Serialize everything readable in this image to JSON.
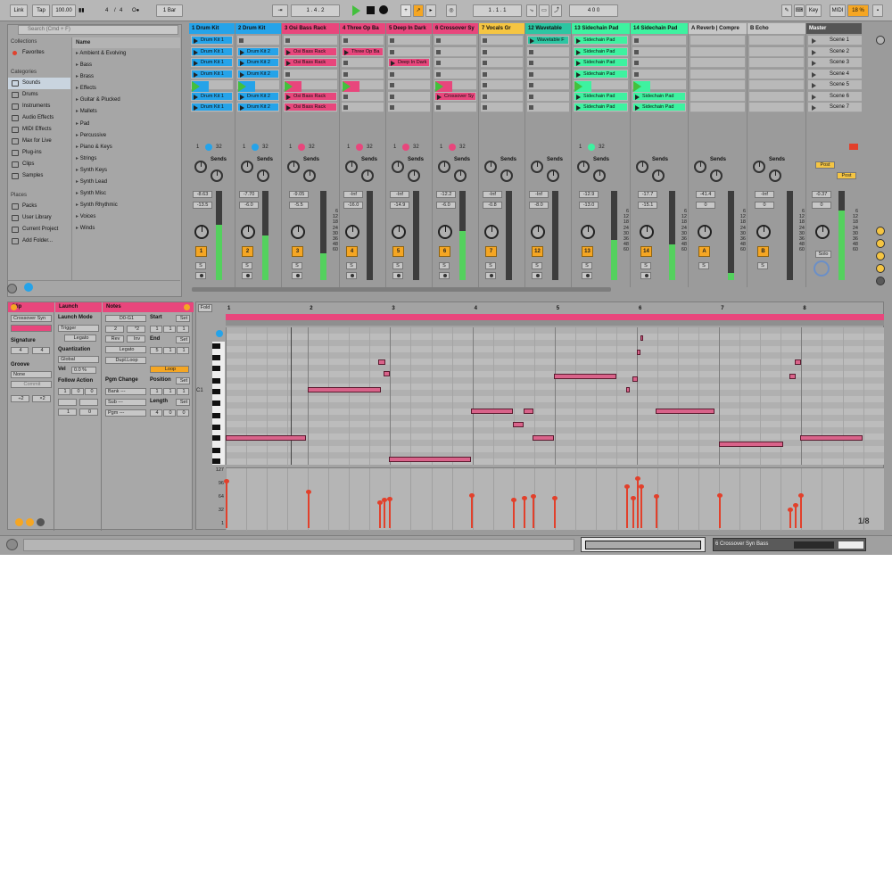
{
  "topbar": {
    "link": "Link",
    "tap": "Tap",
    "tempo": "100.00",
    "signature_num": "4",
    "signature_den": "4",
    "metronome": "O●",
    "quantize": "1 Bar",
    "position": "1 . 4 . 2",
    "arrangement_position": "1 . 1 . 1",
    "loop_length": "4 0 0",
    "key": "Key",
    "midi": "MIDI",
    "cpu": "18 %"
  },
  "browser": {
    "search_placeholder": "Search (Cmd + F)",
    "collections_header": "Collections",
    "favorites": "Favorites",
    "categories_header": "Categories",
    "categories": [
      "Sounds",
      "Drums",
      "Instruments",
      "Audio Effects",
      "MIDI Effects",
      "Max for Live",
      "Plug-ins",
      "Clips",
      "Samples"
    ],
    "places_header": "Places",
    "places": [
      "Packs",
      "User Library",
      "Current Project",
      "Add Folder..."
    ],
    "name_header": "Name",
    "items": [
      "Ambient & Evolving",
      "Bass",
      "Brass",
      "Effects",
      "Guitar & Plucked",
      "Mallets",
      "Pad",
      "Percussive",
      "Piano & Keys",
      "Strings",
      "Synth Keys",
      "Synth Lead",
      "Synth Misc",
      "Synth Rhythmic",
      "Voices",
      "Winds"
    ]
  },
  "tracks": [
    {
      "name": "1 Drum Kit",
      "color": "#25a3e9",
      "clips": [
        "Drum Kit 1",
        "Drum Kit 1",
        "Drum Kit 1",
        "Drum Kit 1",
        "Drum Kit 1",
        "Drum Kit 1",
        "Drum Kit 1"
      ],
      "in": "1",
      "out": "32",
      "vol_a": "-8.63",
      "vol_b": "-13.5",
      "num": "1",
      "meter": 0.62
    },
    {
      "name": "2 Drum Kit",
      "color": "#25a3e9",
      "clips": [
        "",
        "Drum Kit 2",
        "Drum Kit 2",
        "Drum Kit 2",
        "Drum Kit 2",
        "Drum Kit 2",
        "Drum Kit 2"
      ],
      "in": "1",
      "out": "32",
      "vol_a": "-7.70",
      "vol_b": "-6.0",
      "num": "2",
      "meter": 0.5
    },
    {
      "name": "3 Osi Bass Rack",
      "color": "#e8467c",
      "clips": [
        "",
        "Osi Bass Rack",
        "Osi Bass Rack",
        "",
        "Osi Bass Rack",
        "Osi Bass Rack",
        "Osi Bass Rack"
      ],
      "in": "1",
      "out": "32",
      "vol_a": "-9.05",
      "vol_b": "-5.5",
      "num": "3",
      "meter": 0.3
    },
    {
      "name": "4 Three Op Ba",
      "color": "#e8467c",
      "clips": [
        "",
        "Three Op Ba",
        "",
        "",
        "Three Op Ba",
        "",
        ""
      ],
      "in": "1",
      "out": "32",
      "vol_a": "-Inf",
      "vol_b": "-16.0",
      "num": "4",
      "meter": 0
    },
    {
      "name": "5 Deep In Dark",
      "color": "#e8467c",
      "clips": [
        "",
        "",
        "Deep In Dark",
        "",
        "",
        "",
        ""
      ],
      "in": "1",
      "out": "32",
      "vol_a": "-Inf",
      "vol_b": "-14.9",
      "num": "5",
      "meter": 0
    },
    {
      "name": "6 Crossover Sy",
      "color": "#e8467c",
      "clips": [
        "",
        "",
        "",
        "",
        "Crossover Sy",
        "Crossover Sy",
        ""
      ],
      "in": "1",
      "out": "32",
      "vol_a": "-12.2",
      "vol_b": "-6.0",
      "num": "6",
      "meter": 0.55
    },
    {
      "name": "7 Vocals Gr",
      "color": "#f5c542",
      "clips": [
        "",
        "",
        "",
        "",
        "",
        "",
        ""
      ],
      "in": "",
      "out": "",
      "vol_a": "-Inf",
      "vol_b": "-0.8",
      "num": "7",
      "meter": 0
    },
    {
      "name": "12 Wavetable",
      "color": "#2dc5a2",
      "clips": [
        "Wavetable F",
        "",
        "",
        "",
        "",
        "",
        ""
      ],
      "in": "",
      "out": "",
      "vol_a": "-Inf",
      "vol_b": "-8.0",
      "num": "12",
      "meter": 0
    },
    {
      "name": "13 Sidechain Pad",
      "color": "#3ef2a0",
      "clips": [
        "Sidechain Pad",
        "Sidechain Pad",
        "Sidechain Pad",
        "Sidechain Pad",
        "Sidechain Pad",
        "Sidechain Pad",
        "Sidechain Pad"
      ],
      "in": "1",
      "out": "32",
      "vol_a": "-12.9",
      "vol_b": "-13.0",
      "num": "13",
      "meter": 0.45
    },
    {
      "name": "14 Sidechain Pad",
      "color": "#3ef2a0",
      "clips": [
        "",
        "",
        "",
        "",
        "Sidechain Pad",
        "Sidechain Pad",
        "Sidechain Pad"
      ],
      "in": "",
      "out": "",
      "vol_a": "-17.7",
      "vol_b": "-15.1",
      "num": "14",
      "meter": 0.4
    },
    {
      "name": "A Reverb | Compre",
      "color": "#c7c7c7",
      "clips": [],
      "in": "",
      "out": "",
      "vol_a": "-41.4",
      "vol_b": "0",
      "num": "A",
      "meter": 0.08
    },
    {
      "name": "B Echo",
      "color": "#c7c7c7",
      "clips": [],
      "in": "",
      "out": "",
      "vol_a": "-Inf",
      "vol_b": "0",
      "num": "B",
      "meter": 0
    }
  ],
  "master": {
    "name": "Master",
    "scenes": [
      "Scene 1",
      "Scene 2",
      "Scene 3",
      "Scene 4",
      "Scene 5",
      "Scene 6",
      "Scene 7"
    ],
    "post": "Post",
    "vol_a": "-0.37",
    "vol_b": "0",
    "solo": "Solo"
  },
  "mixer_labels": {
    "sends": "Sends",
    "scale": [
      "6",
      "12",
      "18",
      "24",
      "30",
      "36",
      "48",
      "60"
    ],
    "solo": "S"
  },
  "clip_panel": {
    "title": "Clip",
    "clip_name": "Crossover Syn",
    "signature_label": "Signature",
    "sig_num": "4",
    "sig_den": "4",
    "groove_label": "Groove",
    "groove_value": "None",
    "commit": "Commit",
    "half": "÷2",
    "double": "×2"
  },
  "launch_panel": {
    "title": "Launch",
    "mode_label": "Launch Mode",
    "mode": "Trigger",
    "legato": "Legato",
    "quant_label": "Quantization",
    "quant": "Global",
    "vel_label": "Vel",
    "vel": "0.0 %",
    "follow_label": "Follow Action",
    "fa1": "1",
    "fa2": "0",
    "fa3": "0",
    "fa4": "1",
    "fa5": "0"
  },
  "notes_panel": {
    "title": "Notes",
    "range": "D0-G1",
    "transpose": "2",
    "transpose2": "*2",
    "rev": "Rev",
    "inv": "Inv",
    "legato": "Legato",
    "dupl": "Dupl.Loop",
    "start_label": "Start",
    "set": "Set",
    "end_label": "End",
    "start_vals": [
      "1",
      "1",
      "1"
    ],
    "end_vals": [
      "5",
      "1",
      "1"
    ],
    "loop": "Loop",
    "position_label": "Position",
    "pos_vals": [
      "1",
      "1",
      "1"
    ],
    "length_label": "Length",
    "len_vals": [
      "4",
      "0",
      "0"
    ],
    "pgm_label": "Pgm Change",
    "bank": "Bank ---",
    "sub": "Sub ---",
    "pgm": "Pgm ---"
  },
  "editor": {
    "fold": "Fold",
    "ruler": [
      "1",
      "2",
      "3",
      "4",
      "5",
      "6",
      "7",
      "8"
    ],
    "note_label": "C1",
    "vel_scale": [
      "127",
      "96",
      "64",
      "32",
      "1"
    ],
    "zoom": "1/8"
  },
  "statusbar": {
    "track_label": "6 Crossover Syn Bass"
  }
}
